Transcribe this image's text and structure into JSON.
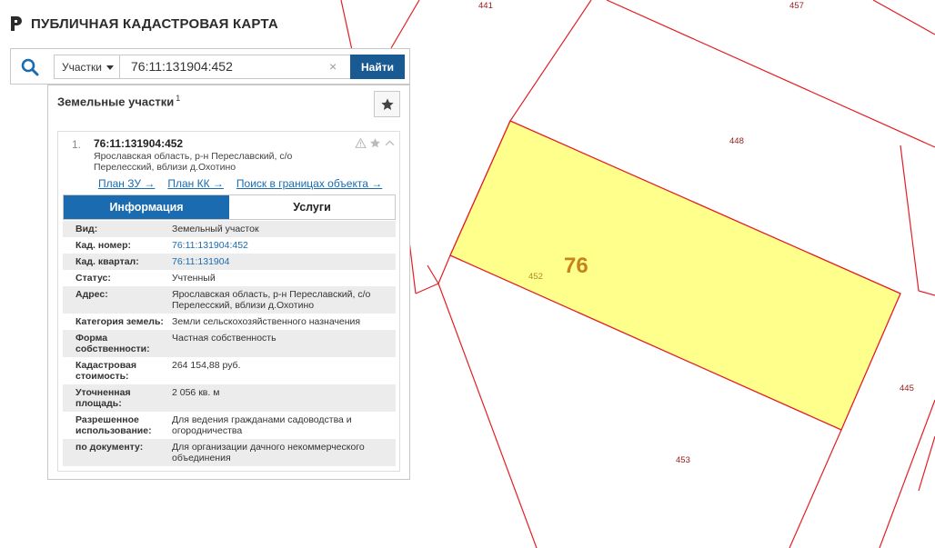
{
  "app": {
    "title": "ПУБЛИЧНАЯ КАДАСТРОВАЯ КАРТА",
    "logo_icon": "pkk-logo-icon"
  },
  "search": {
    "type_label": "Участки",
    "query": "76:11:131904:452",
    "clear": "×",
    "find_label": "Найти"
  },
  "panel": {
    "title": "Земельные участки",
    "count": "1",
    "result": {
      "num": "1.",
      "cad_number": "76:11:131904:452",
      "address": "Ярославская область, р-н Переславский, с/о Перелесский, вблизи д.Охотино",
      "links": [
        "План ЗУ →",
        "План КК →",
        "Поиск в границах объекта →"
      ],
      "tabs": [
        "Информация",
        "Услуги"
      ],
      "properties": [
        {
          "k": "Вид:",
          "v": "Земельный участок"
        },
        {
          "k": "Кад. номер:",
          "v": "76:11:131904:452",
          "link": true
        },
        {
          "k": "Кад. квартал:",
          "v": "76:11:131904",
          "link": true
        },
        {
          "k": "Статус:",
          "v": "Учтенный"
        },
        {
          "k": "Адрес:",
          "v": "Ярославская область, р-н Переславский, с/о Перелесский, вблизи д.Охотино"
        },
        {
          "k": "Категория земель:",
          "v": "Земли сельскохозяйственного назначения"
        },
        {
          "k": "Форма собственности:",
          "v": "Частная собственность"
        },
        {
          "k": "Кадастровая стоимость:",
          "v": "264 154,88 руб."
        },
        {
          "k": "Уточненная площадь:",
          "v": "2 056 кв. м"
        },
        {
          "k": "Разрешенное использование:",
          "v": "Для ведения гражданами садоводства и огородничества"
        },
        {
          "k": "по документу:",
          "v": "Для организации дачного некоммерческого объединения"
        }
      ]
    }
  },
  "map": {
    "parcel_labels": [
      "441",
      "457",
      "448",
      "452",
      "445",
      "453"
    ],
    "region_label": "76",
    "colors": {
      "boundary": "#e31e24",
      "selected_fill": "#ffff8c",
      "selected_stroke": "#e31e24",
      "label": "#9b1d20",
      "region": "#c8811c"
    }
  },
  "colors": {
    "accent": "#1a6bb0",
    "button": "#1a5a93"
  }
}
